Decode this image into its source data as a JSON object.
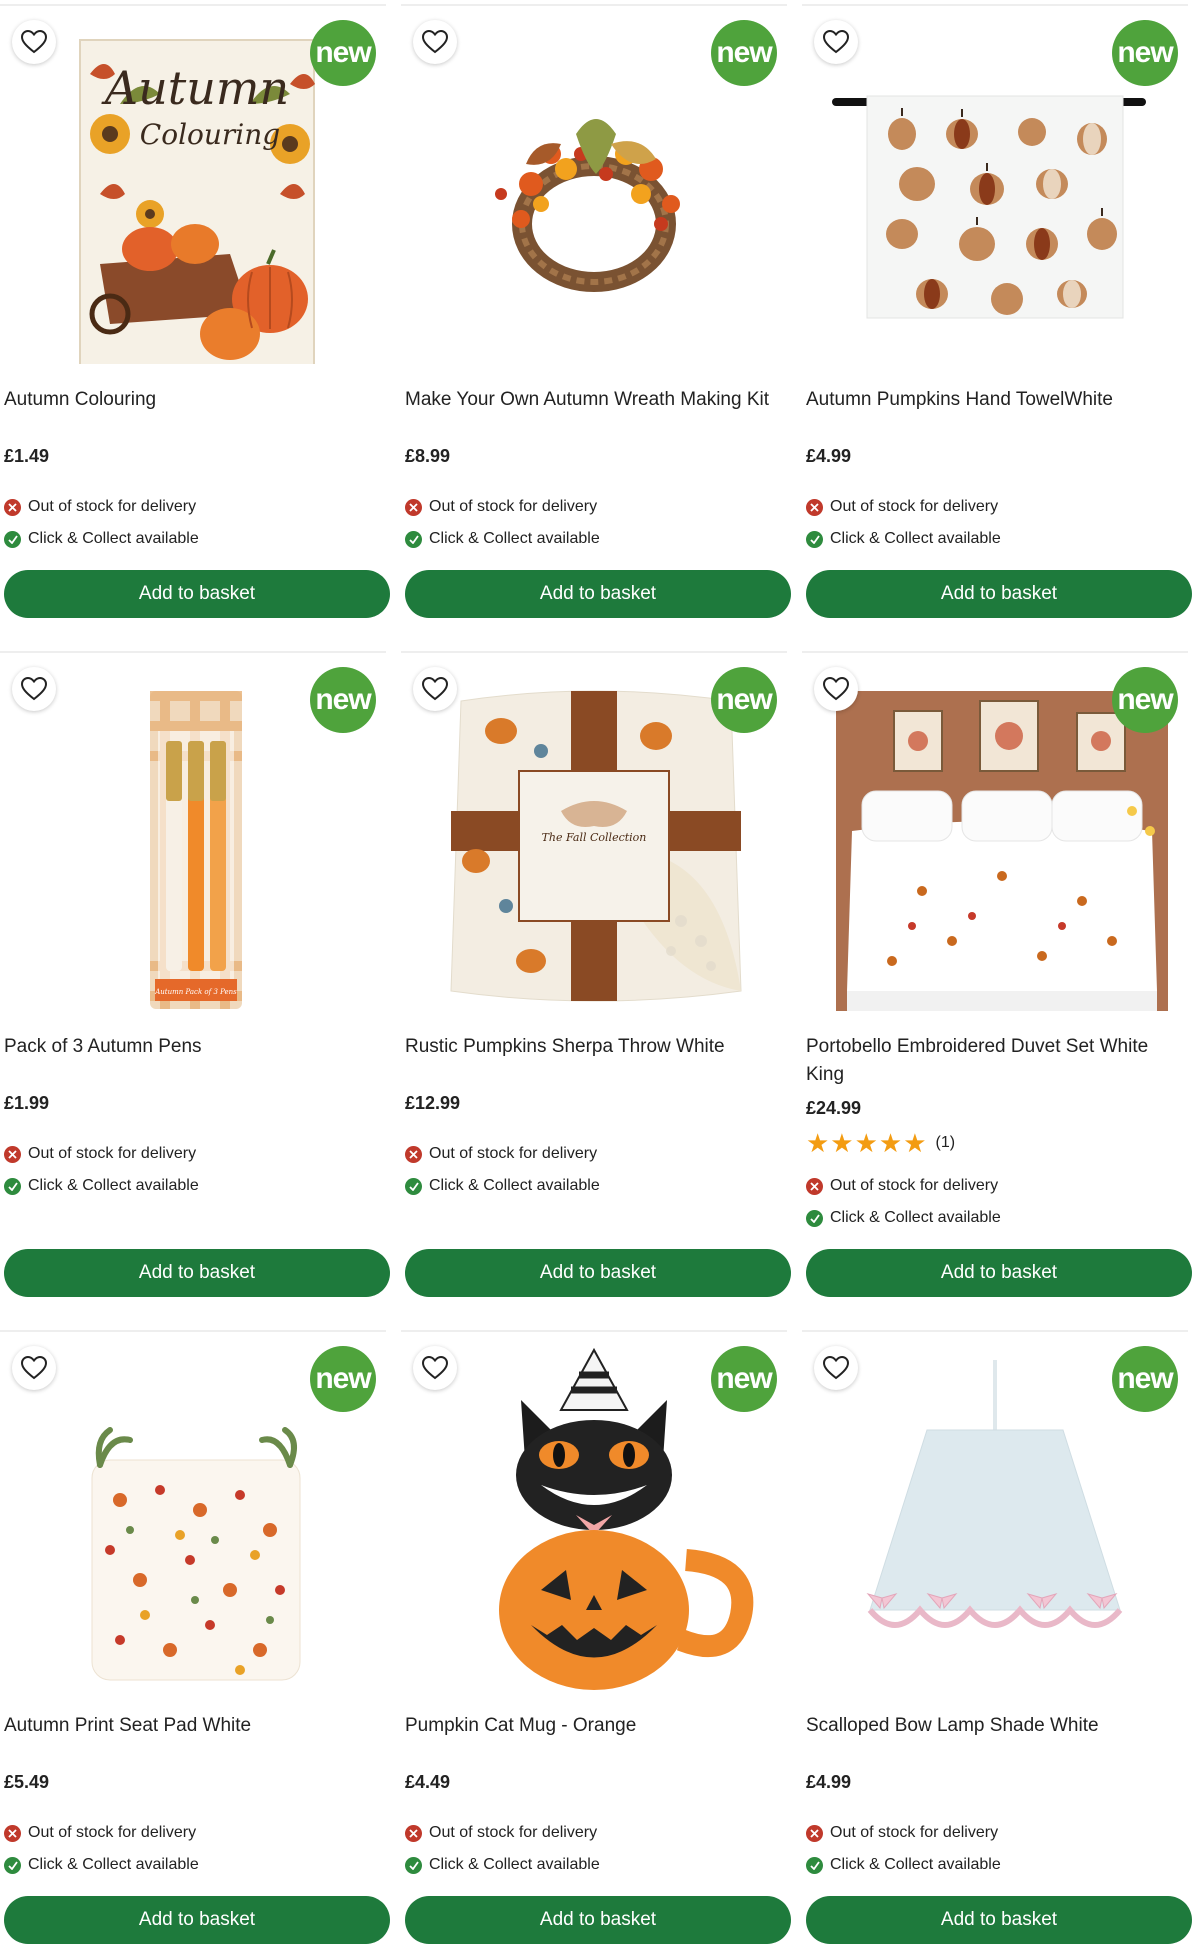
{
  "products": [
    {
      "title": "Autumn Colouring",
      "price": "£1.49",
      "badge": "new",
      "delivery": "Out of stock for delivery",
      "collect": "Click & Collect available",
      "button": "Add to basket",
      "cover_line1": "Autumn",
      "cover_line2": "Colouring"
    },
    {
      "title": "Make Your Own Autumn Wreath Making Kit",
      "price": "£8.99",
      "badge": "new",
      "delivery": "Out of stock for delivery",
      "collect": "Click & Collect available",
      "button": "Add to basket"
    },
    {
      "title": "Autumn Pumpkins Hand TowelWhite",
      "price": "£4.99",
      "badge": "new",
      "delivery": "Out of stock for delivery",
      "collect": "Click & Collect available",
      "button": "Add to basket"
    },
    {
      "title": "Pack of 3 Autumn Pens",
      "price": "£1.99",
      "badge": "new",
      "delivery": "Out of stock for delivery",
      "collect": "Click & Collect available",
      "button": "Add to basket",
      "pack_label": "Autumn Pack of 3 Pens"
    },
    {
      "title": "Rustic Pumpkins Sherpa Throw White",
      "price": "£12.99",
      "badge": "new",
      "delivery": "Out of stock for delivery",
      "collect": "Click & Collect available",
      "button": "Add to basket",
      "label_text": "The Fall Collection"
    },
    {
      "title": "Portobello Embroidered Duvet Set White King",
      "price": "£24.99",
      "badge": "new",
      "rating_count": "(1)",
      "rating": 5,
      "delivery": "Out of stock for delivery",
      "collect": "Click & Collect available",
      "button": "Add to basket"
    },
    {
      "title": "Autumn Print Seat Pad White",
      "price": "£5.49",
      "badge": "new",
      "delivery": "Out of stock for delivery",
      "collect": "Click & Collect available",
      "button": "Add to basket"
    },
    {
      "title": "Pumpkin Cat Mug - Orange",
      "price": "£4.49",
      "badge": "new",
      "delivery": "Out of stock for delivery",
      "collect": "Click & Collect available",
      "button": "Add to basket"
    },
    {
      "title": "Scalloped Bow Lamp Shade White",
      "price": "£4.99",
      "badge": "new",
      "delivery": "Out of stock for delivery",
      "collect": "Click & Collect available",
      "button": "Add to basket"
    }
  ],
  "colors": {
    "button": "#1e7a3c",
    "badge": "#4fa33c",
    "stars": "#f39c12",
    "out_of_stock": "#c0392b",
    "available": "#2e8b3e"
  },
  "icons": {
    "wishlist": "heart-outline-icon",
    "out_of_stock": "cross-circle-icon",
    "available": "check-circle-icon",
    "rating": "star-icon"
  }
}
